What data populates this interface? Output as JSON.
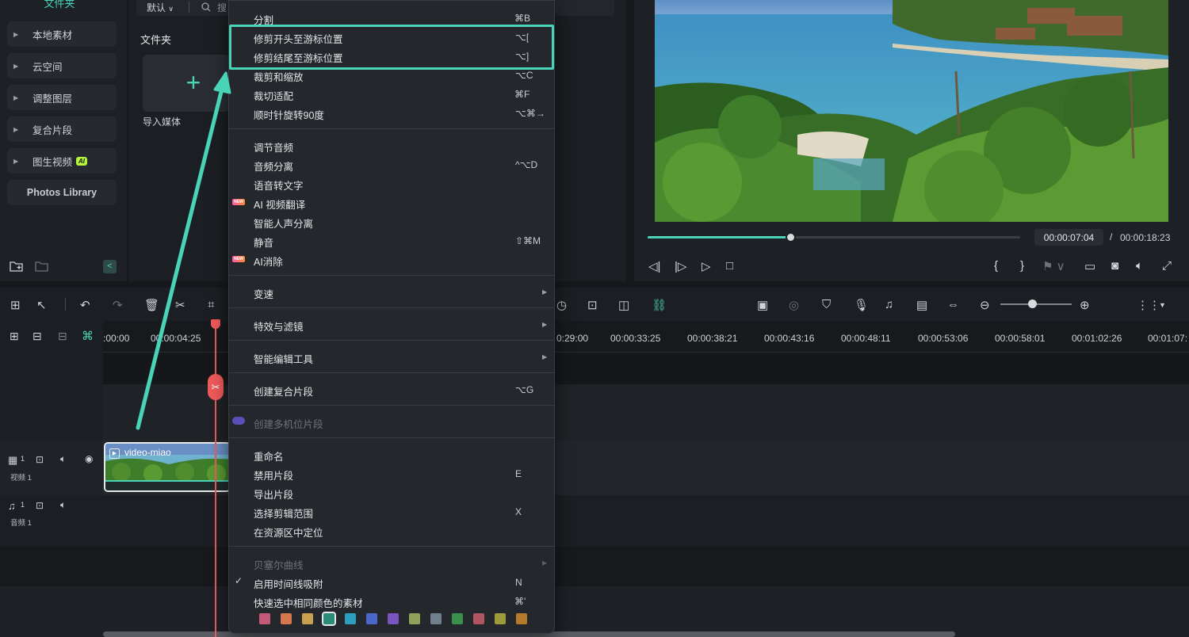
{
  "library": {
    "top_label": "文件夹",
    "items": [
      {
        "label": "本地素材"
      },
      {
        "label": "云空间"
      },
      {
        "label": "调整图层"
      },
      {
        "label": "复合片段"
      },
      {
        "label": "图生视频",
        "badge": "AI"
      }
    ],
    "photos_library": "Photos Library",
    "sort_label": "默认",
    "search_placeholder": "搜",
    "folder_title": "文件夹",
    "import_label": "导入媒体"
  },
  "preview": {
    "progress_fraction": 0.383,
    "time_current": "00:00:07:04",
    "time_separator": "/",
    "time_total": "00:00:18:23"
  },
  "timeline": {
    "ruler_labels": [
      ":00:00",
      "00:00:04:25",
      "0:29:00",
      "00:00:33:25",
      "00:00:38:21",
      "00:00:43:16",
      "00:00:48:11",
      "00:00:53:06",
      "00:00:58:01",
      "00:01:02:26",
      "00:01:07:"
    ],
    "video_track_label": "视频 1",
    "video_track_num": "1",
    "audio_track_label": "音频 1",
    "audio_track_num": "1",
    "clip_name": "video-miao"
  },
  "context_menu": {
    "items": {
      "split": {
        "label": "分割",
        "shortcut": "⌘B"
      },
      "trim_start": {
        "label": "修剪开头至游标位置",
        "shortcut": "⌥["
      },
      "trim_end": {
        "label": "修剪结尾至游标位置",
        "shortcut": "⌥]"
      },
      "crop_zoom": {
        "label": "裁剪和缩放",
        "shortcut": "⌥C"
      },
      "crop_fit": {
        "label": "裁切适配",
        "shortcut": "⌘F"
      },
      "rotate": {
        "label": "顺时针旋转90度",
        "shortcut": "⌥⌘→"
      },
      "adjust_audio": {
        "label": "调节音频",
        "shortcut": ""
      },
      "audio_detach": {
        "label": "音频分离",
        "shortcut": "^⌥D"
      },
      "speech_to_text": {
        "label": "语音转文字",
        "shortcut": ""
      },
      "ai_translate": {
        "label": "AI 视频翻译",
        "shortcut": ""
      },
      "vocal_separation": {
        "label": "智能人声分离",
        "shortcut": ""
      },
      "mute": {
        "label": "静音",
        "shortcut": "⇧⌘M"
      },
      "ai_remove": {
        "label": "AI消除",
        "shortcut": ""
      },
      "speed": {
        "label": "变速",
        "shortcut": ""
      },
      "effects": {
        "label": "特效与滤镜",
        "shortcut": ""
      },
      "smart_edit": {
        "label": "智能编辑工具",
        "shortcut": ""
      },
      "compound": {
        "label": "创建复合片段",
        "shortcut": "⌥G"
      },
      "multicam": {
        "label": "创建多机位片段",
        "shortcut": ""
      },
      "rename": {
        "label": "重命名",
        "shortcut": ""
      },
      "disable": {
        "label": "禁用片段",
        "shortcut": "E"
      },
      "export_clip": {
        "label": "导出片段",
        "shortcut": ""
      },
      "select_range": {
        "label": "选择剪辑范围",
        "shortcut": "X"
      },
      "locate": {
        "label": "在资源区中定位",
        "shortcut": ""
      },
      "bezier": {
        "label": "贝塞尔曲线",
        "shortcut": ""
      },
      "snap": {
        "label": "启用时间线吸附",
        "shortcut": "N"
      },
      "select_same_color": {
        "label": "快速选中相同颜色的素材",
        "shortcut": "⌘'"
      }
    },
    "new_badge": "NEW",
    "color_swatches": [
      "#c45a78",
      "#d5784f",
      "#c9a04e",
      "#2c8a78",
      "#2c9fc0",
      "#4a67c9",
      "#7a55c2",
      "#8fa25a",
      "#6f7f8c",
      "#3b8f4d",
      "#b05561",
      "#9c9a3a",
      "#b57a2a"
    ]
  },
  "colors": {
    "accent": "#49d3b7",
    "playhead": "#f05a5a"
  }
}
